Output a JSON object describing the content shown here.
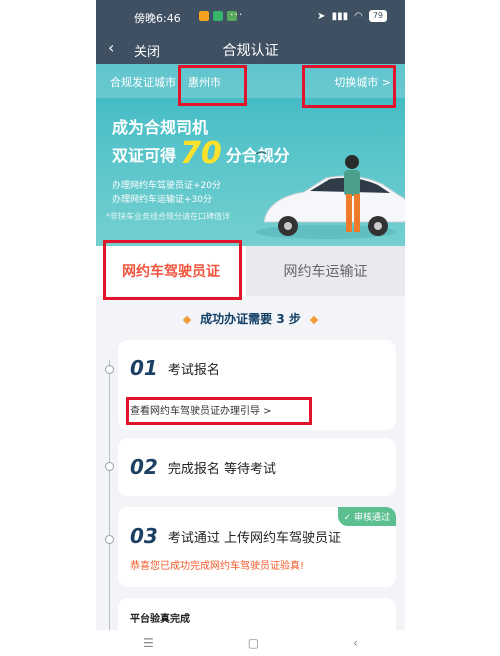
{
  "status_bar": {
    "time": "傍晚6:46",
    "dots": "···",
    "battery": "79"
  },
  "nav": {
    "back_icon": "chevron-left-icon",
    "close_label": "关闭",
    "title": "合规认证"
  },
  "city": {
    "label": "合规发证城市：",
    "name": "惠州市",
    "switch_label": "切换城市 >"
  },
  "banner": {
    "title": "成为合规司机",
    "subtitle_prefix": "双证可得",
    "big_number": "70",
    "subtitle_suffix": "分合规分",
    "line1": "办理网约车驾驶员证+20分",
    "line2": "办理网约车运输证+30分",
    "note": "*非快车业务线合规分请在口碑值详"
  },
  "tabs": [
    {
      "label": "网约车驾驶员证"
    },
    {
      "label": "网约车运输证"
    }
  ],
  "steps_heading": "成功办证需要 3 步",
  "steps": [
    {
      "number": "01",
      "label": "考试报名",
      "link": "查看网约车驾驶员证办理引导 >"
    },
    {
      "number": "02",
      "label": "完成报名 等待考试"
    },
    {
      "number": "03",
      "label": "考试通过 上传网约车驾驶员证",
      "badge": "审核通过",
      "success": "恭喜您已成功完成网约车驾驶员证验真!"
    }
  ],
  "bottom_card": {
    "label": "平台验真完成"
  },
  "android_nav": {
    "menu": "☰",
    "home": "▢",
    "back": "‹"
  },
  "colors": {
    "nav_bg": "#3f5063",
    "accent_red": "#e0142a",
    "tab_active": "#f1543d",
    "badge_green": "#5bbf8f"
  }
}
